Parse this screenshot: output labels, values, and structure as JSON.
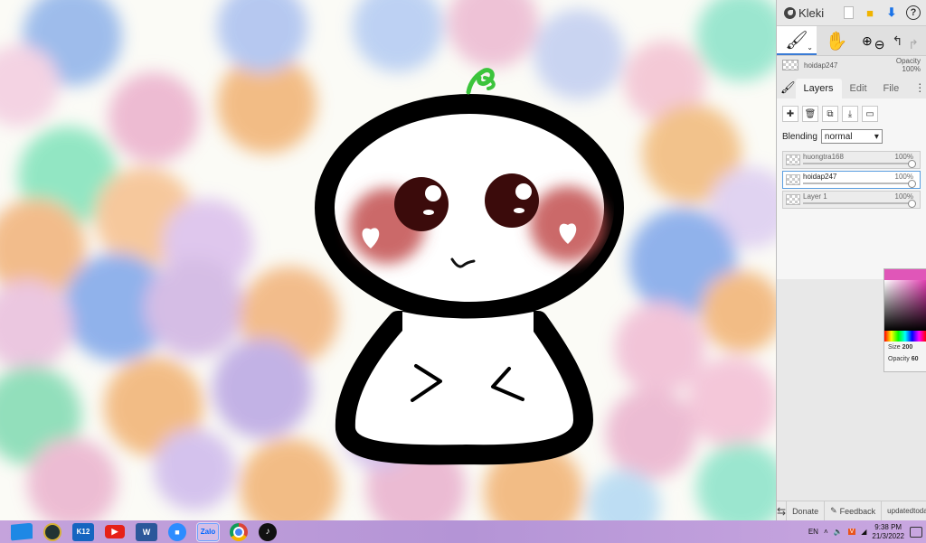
{
  "app": {
    "title": "Kleki"
  },
  "topbar": {
    "icons": [
      "new-file-icon",
      "open-folder-icon",
      "download-icon",
      "help-icon"
    ],
    "help_label": "?"
  },
  "tools": {
    "brush_caret": "⌄",
    "zoom_in": "⊕",
    "zoom_out": "⊖",
    "undo": "↰",
    "redo": "↱"
  },
  "current_layer": {
    "name": "hoidap247",
    "opacity_label": "Opacity",
    "opacity_value": "100%"
  },
  "tabs": [
    {
      "label": "Layers",
      "active": true
    },
    {
      "label": "Edit",
      "active": false
    },
    {
      "label": "File",
      "active": false
    }
  ],
  "tab_more": "⋮",
  "layer_buttons": [
    "add-layer",
    "delete-layer",
    "duplicate-layer",
    "merge-layer",
    "rename-layer"
  ],
  "blending": {
    "label": "Blending",
    "value": "normal"
  },
  "layers": [
    {
      "name": "huongtra168",
      "opacity": "100%",
      "selected": false
    },
    {
      "name": "hoidap247",
      "opacity": "100%",
      "selected": true
    },
    {
      "name": "Layer 1",
      "opacity": "100%",
      "selected": false
    }
  ],
  "picker": {
    "size_label": "Size",
    "size_value": "200",
    "opacity_label": "Opacity",
    "opacity_value": "60"
  },
  "footer": {
    "donate": "Donate",
    "feedback": "Feedback",
    "updated_line1": "updated",
    "updated_line2": "today"
  },
  "taskbar": {
    "apps": [
      "start",
      "game",
      "K12",
      "youtube",
      "W",
      "zoom",
      "Zalo",
      "chrome",
      "tiktok"
    ],
    "k12_label": "K12",
    "word_label": "W",
    "zalo_label": "Zalo",
    "tiktok_label": "♪",
    "lang": "EN",
    "time": "9:38 PM",
    "date": "21/3/2022"
  },
  "colors": {
    "accent": "#3a7bd5",
    "taskbar": "#b494d6",
    "blush": "#c0504d",
    "sprout": "#3cc43c"
  }
}
